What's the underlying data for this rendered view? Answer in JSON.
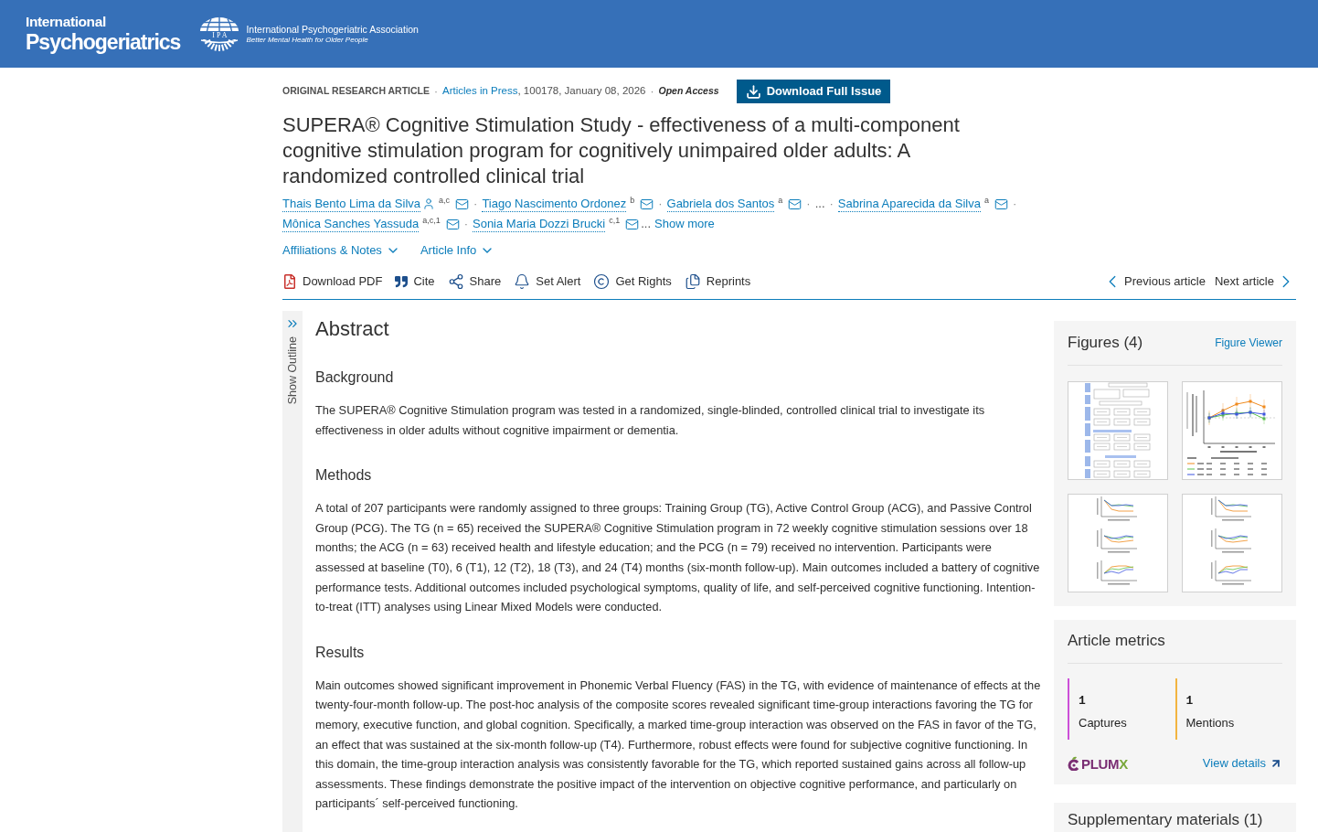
{
  "header": {
    "journal_logo": [
      "International",
      "Psychogeriatrics"
    ],
    "association": {
      "emblem_text": "IPA",
      "name": "International Psychogeriatric Association",
      "tagline": "Better Mental Health for Older People"
    }
  },
  "article": {
    "meta": [
      {
        "kind": "label",
        "text": "ORIGINAL RESEARCH ARTICLE",
        "separator_after": "·"
      },
      {
        "kind": "link",
        "text": "Articles in Press"
      },
      {
        "kind": "plain",
        "text": ", 100178, January 08, 2026",
        "separator_after": "·"
      },
      {
        "kind": "emphasis",
        "text": "Open Access"
      }
    ],
    "download_issue_button": "Download Full Issue",
    "title": "SUPERA® Cognitive Stimulation Study - effectiveness of a multi-component cognitive stimulation program for cognitively unimpaired older adults: A randomized controlled clinical trial",
    "authors": [
      {
        "kind": "author",
        "name": "Thais Bento Lima da Silva",
        "corresponding": true,
        "affiliations": "a,c",
        "separator_after": "·"
      },
      {
        "kind": "author",
        "name": "Tiago Nascimento Ordonez",
        "corresponding": false,
        "affiliations": "b",
        "separator_after": "·"
      },
      {
        "kind": "author",
        "name": "Gabriela dos Santos",
        "corresponding": false,
        "affiliations": "a",
        "separator_after": "·"
      },
      {
        "kind": "ellipsis",
        "text": "...",
        "separator_after": "·"
      },
      {
        "kind": "author",
        "name": "Sabrina Aparecida da Silva",
        "corresponding": false,
        "affiliations": "a",
        "separator_after": "·"
      },
      {
        "kind": "author",
        "name": "Mônica Sanches Yassuda",
        "corresponding": false,
        "affiliations": "a,c,1",
        "separator_after": "·"
      },
      {
        "kind": "author",
        "name": "Sonia Maria Dozzi Brucki",
        "corresponding": false,
        "affiliations": "c,1"
      }
    ],
    "show_more": {
      "prefix": "...",
      "label": "Show more"
    },
    "toggles": [
      {
        "label": "Affiliations & Notes",
        "expanded": false
      },
      {
        "label": "Article Info",
        "expanded": false
      }
    ],
    "toolbar": [
      "Download PDF",
      "Cite",
      "Share",
      "Set Alert",
      "Get Rights",
      "Reprints"
    ],
    "navigation": {
      "previous": "Previous article",
      "next": "Next article"
    }
  },
  "outline": {
    "label": "Show Outline",
    "expanded": false
  },
  "abstract": {
    "title": "Abstract",
    "sections": [
      {
        "heading": "Background",
        "text": "The SUPERA® Cognitive Stimulation program was tested in a randomized, single-blinded, controlled clinical trial to investigate its effectiveness in older adults without cognitive impairment or dementia."
      },
      {
        "heading": "Methods",
        "text": "A total of 207 participants were randomly assigned to three groups: Training Group (TG), Active Control Group (ACG), and Passive Control Group (PCG). The TG (n = 65) received the SUPERA® Cognitive Stimulation program in 72 weekly cognitive stimulation sessions over 18 months; the ACG (n = 63) received health and lifestyle education; and the PCG (n = 79) received no intervention. Participants were assessed at baseline (T0), 6 (T1), 12 (T2), 18 (T3), and 24 (T4) months (six-month follow-up). Main outcomes included a battery of cognitive performance tests. Additional outcomes included psychological symptoms, quality of life, and self-perceived cognitive functioning. Intention-to-treat (ITT) analyses using Linear Mixed Models were conducted."
      },
      {
        "heading": "Results",
        "text": "Main outcomes showed significant improvement in Phonemic Verbal Fluency (FAS) in the TG, with evidence of maintenance of effects at the twenty-four-month follow-up. The post-hoc analysis of the composite scores revealed significant time-group interactions favoring the TG for memory, executive function, and global cognition. Specifically, a marked time-group interaction was observed on the FAS in favor of the TG, an effect that was sustained at the six-month follow-up (T4). Furthermore, robust effects were found for subjective cognitive functioning. In this domain, the time-group interaction analysis was consistently favorable for the TG, which reported sustained gains across all follow-up assessments. These findings demonstrate the positive impact of the intervention on objective cognitive performance, and particularly on participants´ self-perceived functioning."
      }
    ]
  },
  "sidebar": {
    "figures": {
      "title": "Figures (4)",
      "viewer_link": "Figure Viewer",
      "thumbnails": [
        {
          "kind": "flowchart"
        },
        {
          "kind": "line_chart"
        },
        {
          "kind": "chart_stack"
        },
        {
          "kind": "chart_stack"
        }
      ]
    },
    "metrics": {
      "title": "Article metrics",
      "items": [
        {
          "value": "1",
          "label": "Captures",
          "color": "#cc4fd8"
        },
        {
          "value": "1",
          "label": "Mentions",
          "color": "#f2b440"
        }
      ],
      "logo": {
        "text": "PLUM",
        "accent": "X"
      },
      "details_link": "View details"
    },
    "supplementary": {
      "title": "Supplementary materials (1)"
    }
  }
}
